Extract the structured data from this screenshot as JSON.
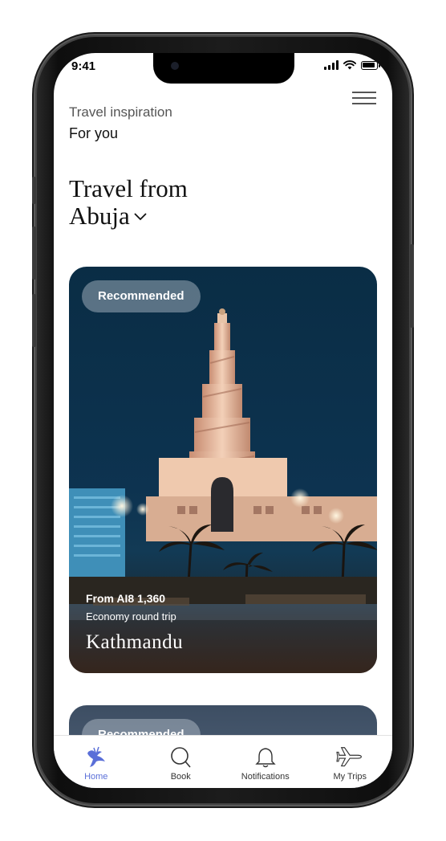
{
  "status": {
    "time": "9:41"
  },
  "header": {
    "subtitle": "Travel inspiration",
    "subtitle2": "For you",
    "headline": "Travel from",
    "origin_city": "Abuja"
  },
  "cards": [
    {
      "badge": "Recommended",
      "price": "From AI8 1,360",
      "trip_type": "Economy round trip",
      "destination": "Kathmandu"
    },
    {
      "badge": "Recommended"
    }
  ],
  "tabbar": {
    "items": [
      {
        "label": "Home",
        "icon": "oryx-logo-icon",
        "active": true
      },
      {
        "label": "Book",
        "icon": "search-icon",
        "active": false
      },
      {
        "label": "Notifications",
        "icon": "bell-icon",
        "active": false
      },
      {
        "label": "My Trips",
        "icon": "airplane-icon",
        "active": false
      }
    ]
  },
  "colors": {
    "accent": "#5a6fd8",
    "card_sky": "#0d3350",
    "text_primary": "#111111"
  }
}
